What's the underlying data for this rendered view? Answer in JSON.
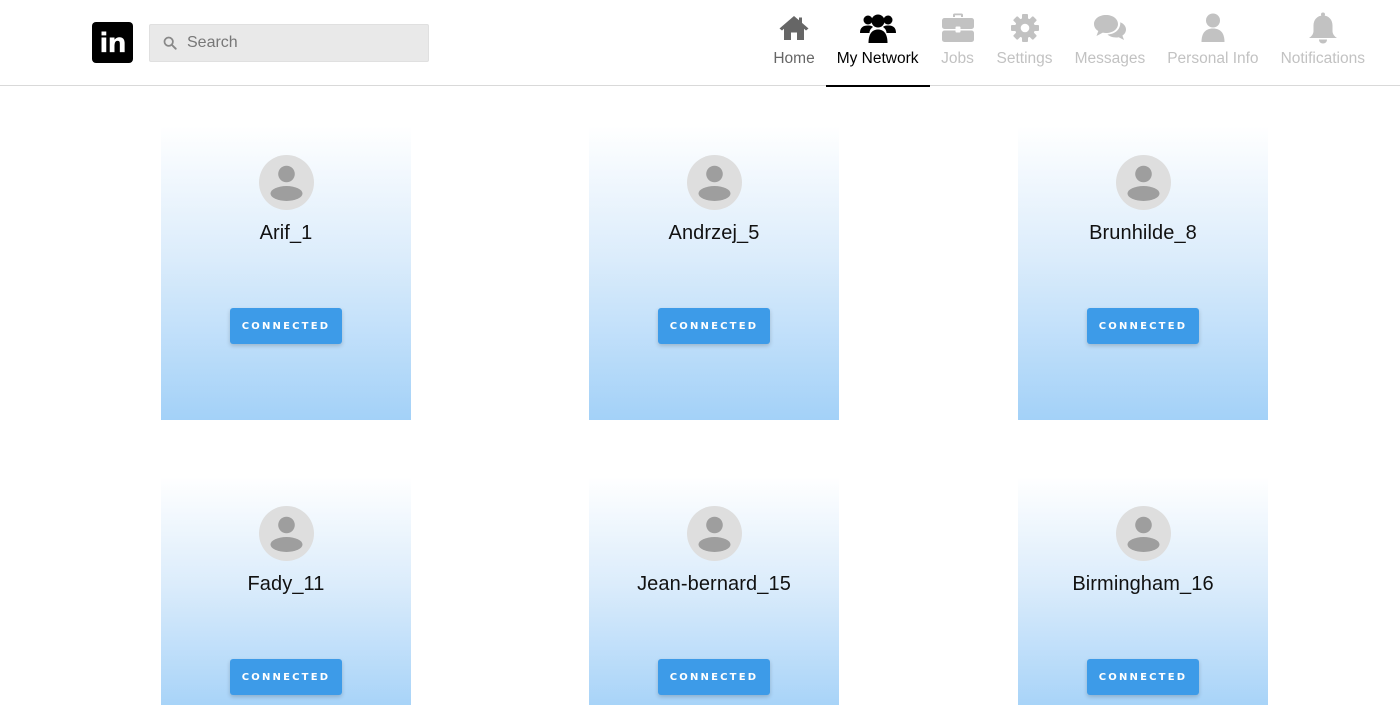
{
  "brand": {
    "logo_text": "in"
  },
  "search": {
    "placeholder": "Search"
  },
  "nav": {
    "items": [
      {
        "label": "Home",
        "icon": "home-icon",
        "state": "normal"
      },
      {
        "label": "My Network",
        "icon": "users-icon",
        "state": "active"
      },
      {
        "label": "Jobs",
        "icon": "briefcase-icon",
        "state": "inactive"
      },
      {
        "label": "Settings",
        "icon": "gear-icon",
        "state": "inactive"
      },
      {
        "label": "Messages",
        "icon": "chat-icon",
        "state": "inactive"
      },
      {
        "label": "Personal Info",
        "icon": "user-icon",
        "state": "inactive"
      },
      {
        "label": "Notifications",
        "icon": "bell-icon",
        "state": "inactive"
      }
    ]
  },
  "connections": [
    {
      "name": "Arif_1",
      "button": "CONNECTED"
    },
    {
      "name": "Andrzej_5",
      "button": "CONNECTED"
    },
    {
      "name": "Brunhilde_8",
      "button": "CONNECTED"
    },
    {
      "name": "Fady_11",
      "button": "CONNECTED"
    },
    {
      "name": "Jean-bernard_15",
      "button": "CONNECTED"
    },
    {
      "name": "Birmingham_16",
      "button": "CONNECTED"
    }
  ],
  "colors": {
    "accent_button": "#3d9be8",
    "card_gradient_bottom": "#a3d1f8",
    "nav_active": "#000000",
    "nav_inactive": "#c2c2c2"
  }
}
